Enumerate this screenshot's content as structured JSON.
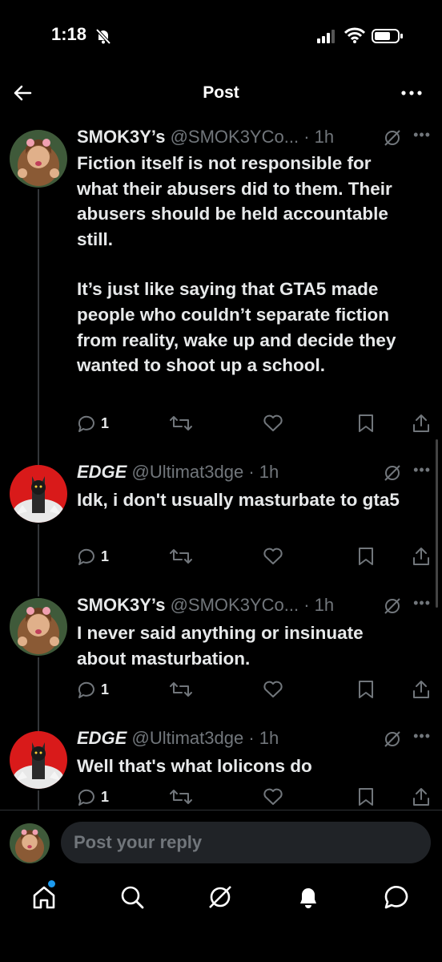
{
  "status": {
    "time": "1:18"
  },
  "topbar": {
    "title": "Post"
  },
  "posts": [
    {
      "name": "SMOK3Y’s",
      "handle": "@SMOK3YCo...",
      "sep": " · ",
      "time": "1h",
      "paragraphs": [
        "Fiction itself is not responsible for what their abusers did to them. Their abusers should be held accountable still.",
        "It’s just like saying that GTA5 made people who couldn’t separate fiction from reality, wake up and decide they wanted to shoot up a school."
      ],
      "replies": "1"
    },
    {
      "name": "EDGE",
      "handle": "@Ultimat3dge",
      "sep": " · ",
      "time": "1h",
      "paragraphs": [
        "Idk, i don't usually masturbate to gta5"
      ],
      "replies": "1"
    },
    {
      "name": "SMOK3Y’s",
      "handle": "@SMOK3YCo...",
      "sep": " · ",
      "time": "1h",
      "paragraphs": [
        "I never said anything or insinuate about masturbation."
      ],
      "replies": "1"
    },
    {
      "name": "EDGE",
      "handle": "@Ultimat3dge",
      "sep": " · ",
      "time": "1h",
      "paragraphs": [
        "Well that's what lolicons do"
      ],
      "replies": "1"
    }
  ],
  "reply": {
    "placeholder": "Post your reply"
  },
  "colors": {
    "background": "#000000",
    "text": "#e7e9ea",
    "muted": "#71767b",
    "accent": "#1d9bf0",
    "input": "#202327"
  },
  "icons": [
    "back-arrow-icon",
    "more-icon",
    "grok-icon",
    "reply-icon",
    "repost-icon",
    "like-icon",
    "bookmark-icon",
    "share-icon",
    "home-icon",
    "search-icon",
    "grok-tab-icon",
    "notifications-icon",
    "messages-icon"
  ]
}
